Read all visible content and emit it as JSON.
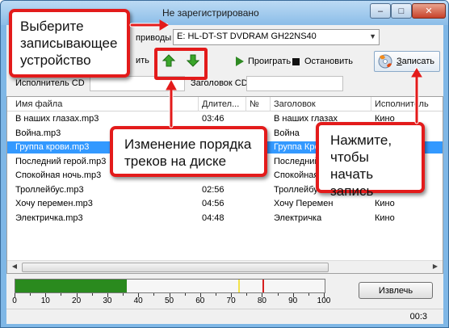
{
  "window": {
    "title": "Не зарегистрировано",
    "minimize_label": "–",
    "maximize_label": "□",
    "close_label": "✕"
  },
  "drive": {
    "label": "приводы",
    "selected": "E: HL-DT-ST DVDRAM GH22NS40"
  },
  "toolbar": {
    "partial_left_label": "ить",
    "play_label": "Проиграть",
    "stop_label": "Остановить",
    "burn_label": "Записать",
    "burn_label_first": "З",
    "burn_label_rest": "аписать"
  },
  "cd_info": {
    "artist_label": "Исполнитель CD",
    "artist_value": "",
    "album_label": "Заголовок CD",
    "album_value": ""
  },
  "list": {
    "columns": [
      "Имя файла",
      "Длител...",
      "№",
      "Заголовок",
      "Исполнитель"
    ],
    "rows": [
      {
        "file": "В наших глазах.mp3",
        "duration": "03:46",
        "num": "",
        "title": "В наших глазах",
        "artist": "Кино",
        "selected": false
      },
      {
        "file": "Война.mp3",
        "duration": "",
        "num": "",
        "title": "Война",
        "artist": "",
        "selected": false
      },
      {
        "file": "Группа крови.mp3",
        "duration": "",
        "num": "",
        "title": "Группа Крови",
        "artist": "",
        "selected": true
      },
      {
        "file": "Последний герой.mp3",
        "duration": "",
        "num": "",
        "title": "Последний",
        "artist": "",
        "selected": false
      },
      {
        "file": "Спокойная ночь.mp3",
        "duration": "",
        "num": "",
        "title": "Спокойная",
        "artist": "",
        "selected": false
      },
      {
        "file": "Троллейбус.mp3",
        "duration": "02:56",
        "num": "",
        "title": "Троллейбус",
        "artist": "Кино",
        "selected": false
      },
      {
        "file": "Хочу перемен.mp3",
        "duration": "04:56",
        "num": "",
        "title": "Хочу Перемен",
        "artist": "Кино",
        "selected": false
      },
      {
        "file": "Электричка.mp3",
        "duration": "04:48",
        "num": "",
        "title": "Электричка",
        "artist": "Кино",
        "selected": false
      }
    ]
  },
  "meter": {
    "level_fraction": 0.36,
    "yellow_marker_value": 72,
    "red_marker_value": 80,
    "tick_labels": [
      "0",
      "10",
      "20",
      "30",
      "40",
      "50",
      "60",
      "70",
      "80",
      "90",
      "100"
    ]
  },
  "eject_label": "Извлечь",
  "status": {
    "time": "00:3"
  },
  "callouts": {
    "device": "Выберите записывающее устройство",
    "order": "Изменение порядка треков на диске",
    "burn": "Нажмите, чтобы начать запись"
  },
  "icons": {
    "up": "arrow-up-icon",
    "down": "arrow-down-icon",
    "play": "play-icon",
    "stop": "stop-icon",
    "burn": "burn-disc-icon"
  },
  "colors": {
    "callout_border": "#e31b1b",
    "selection": "#3399ff",
    "meter_green": "#2a8a1e",
    "arrow_green": "#3aa62a"
  }
}
